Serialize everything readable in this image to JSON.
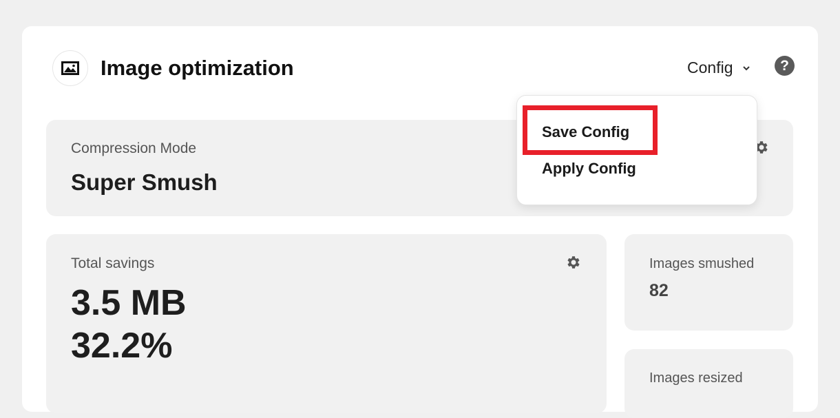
{
  "header": {
    "title": "Image optimization",
    "icon": "image-icon",
    "config_label": "Config",
    "help_icon": "question-icon",
    "help_glyph": "?"
  },
  "config_menu": {
    "items": [
      {
        "label": "Save Config",
        "highlighted": true
      },
      {
        "label": "Apply Config",
        "highlighted": false
      }
    ],
    "highlight_color": "#e8202a"
  },
  "compression": {
    "label": "Compression Mode",
    "value": "Super Smush"
  },
  "savings": {
    "label": "Total savings",
    "size": "3.5 MB",
    "percent": "32.2%"
  },
  "stats": [
    {
      "label": "Images smushed",
      "value": "82"
    },
    {
      "label": "Images resized",
      "value": ""
    }
  ]
}
